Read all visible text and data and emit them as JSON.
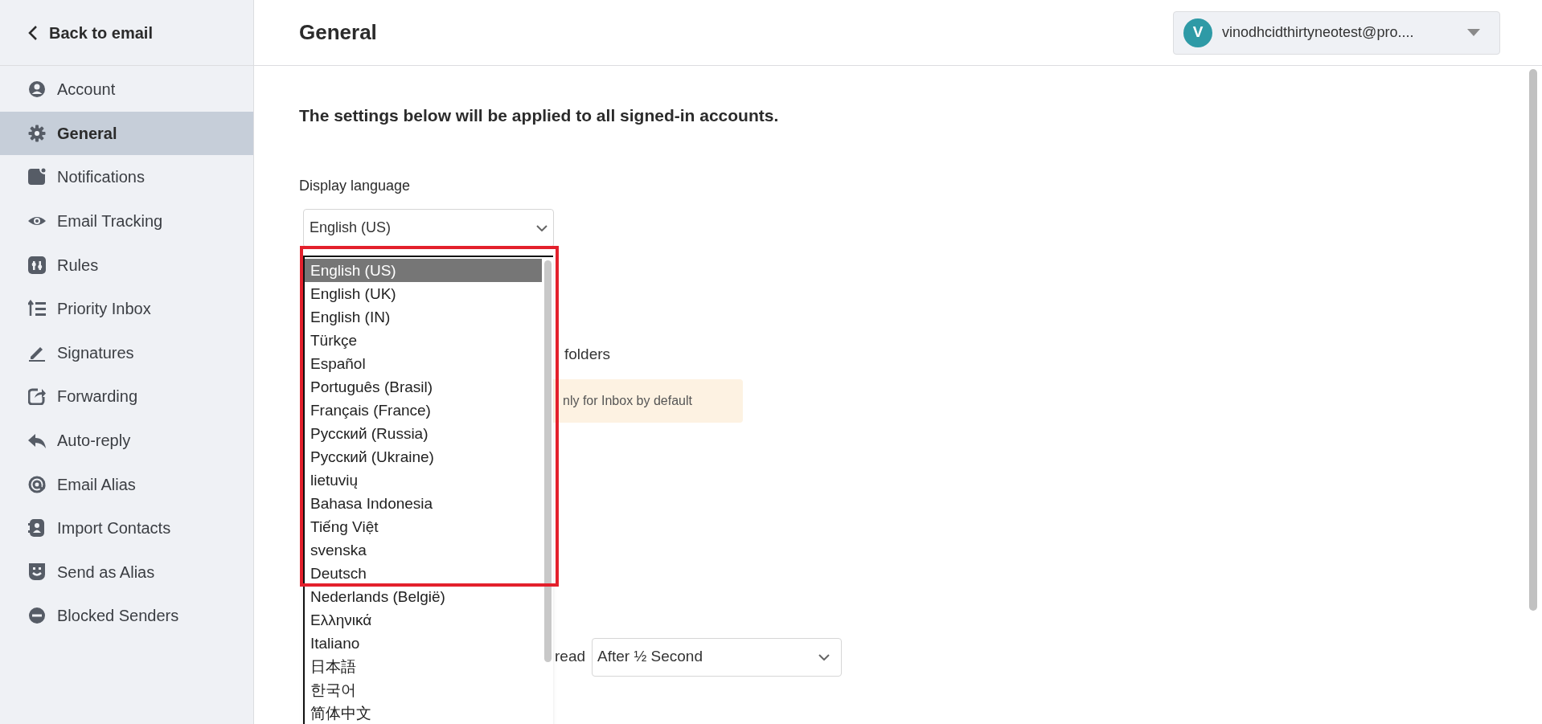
{
  "sidebar": {
    "back_link": "Back to email",
    "items": [
      {
        "label": "Account",
        "selected": false
      },
      {
        "label": "General",
        "selected": true
      },
      {
        "label": "Notifications",
        "selected": false
      },
      {
        "label": "Email Tracking",
        "selected": false
      },
      {
        "label": "Rules",
        "selected": false
      },
      {
        "label": "Priority Inbox",
        "selected": false
      },
      {
        "label": "Signatures",
        "selected": false
      },
      {
        "label": "Forwarding",
        "selected": false
      },
      {
        "label": "Auto-reply",
        "selected": false
      },
      {
        "label": "Email Alias",
        "selected": false
      },
      {
        "label": "Import Contacts",
        "selected": false
      },
      {
        "label": "Send as Alias",
        "selected": false
      },
      {
        "label": "Blocked Senders",
        "selected": false
      }
    ]
  },
  "header": {
    "title": "General",
    "account": {
      "avatar_letter": "V",
      "email": "vinodhcidthirtyneotest@pro...."
    }
  },
  "content": {
    "intro": "The settings below will be applied to all signed-in accounts.",
    "display_language": {
      "label": "Display language",
      "value": "English (US)",
      "options": [
        {
          "label": "English (US)",
          "selected": true
        },
        {
          "label": "English (UK)",
          "selected": false
        },
        {
          "label": "English (IN)",
          "selected": false
        },
        {
          "label": "Türkçe",
          "selected": false
        },
        {
          "label": "Español",
          "selected": false
        },
        {
          "label": "Português (Brasil)",
          "selected": false
        },
        {
          "label": "Français (France)",
          "selected": false
        },
        {
          "label": "Русский (Russia)",
          "selected": false
        },
        {
          "label": "Русский (Ukraine)",
          "selected": false
        },
        {
          "label": "lietuvių",
          "selected": false
        },
        {
          "label": "Bahasa Indonesia",
          "selected": false
        },
        {
          "label": "Tiếng Việt",
          "selected": false
        },
        {
          "label": "svenska",
          "selected": false
        },
        {
          "label": "Deutsch",
          "selected": false
        },
        {
          "label": "Nederlands (België)",
          "selected": false
        },
        {
          "label": "Ελληνικά",
          "selected": false
        },
        {
          "label": "Italiano",
          "selected": false
        },
        {
          "label": "日本語",
          "selected": false
        },
        {
          "label": "한국어",
          "selected": false
        },
        {
          "label": "简体中文",
          "selected": false
        }
      ]
    },
    "folders_option_fragment": "folders",
    "notice_fragment": "nly for Inbox by default",
    "mark_read": {
      "label_fragment": "read",
      "value": "After ½ Second"
    }
  }
}
